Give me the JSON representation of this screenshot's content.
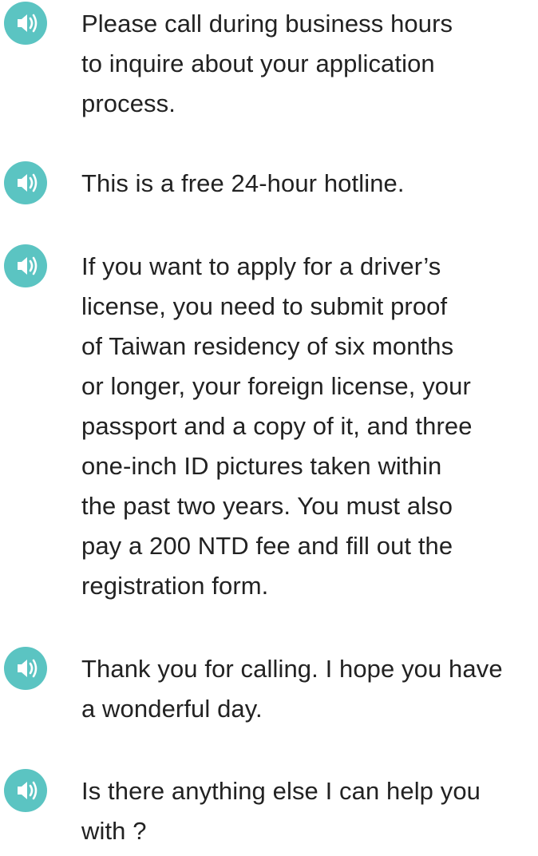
{
  "accent_color": "#5bc4c2",
  "icon": "speaker-icon",
  "items": [
    {
      "text": "Please call during business hours\nto inquire about your application\nprocess."
    },
    {
      "text": "This is a free 24-hour hotline."
    },
    {
      "text": "If you want to apply for a driver’s\nlicense, you need to submit proof\nof Taiwan residency of six months\nor longer, your foreign license, your\npassport and a copy of it, and three\none-inch ID pictures taken within\nthe past two years. You must also\npay a 200 NTD fee and fill out the\nregistration form."
    },
    {
      "text": "Thank you for calling. I hope you have\na wonderful day."
    },
    {
      "text": "Is there anything else I can help you\nwith ?"
    }
  ]
}
